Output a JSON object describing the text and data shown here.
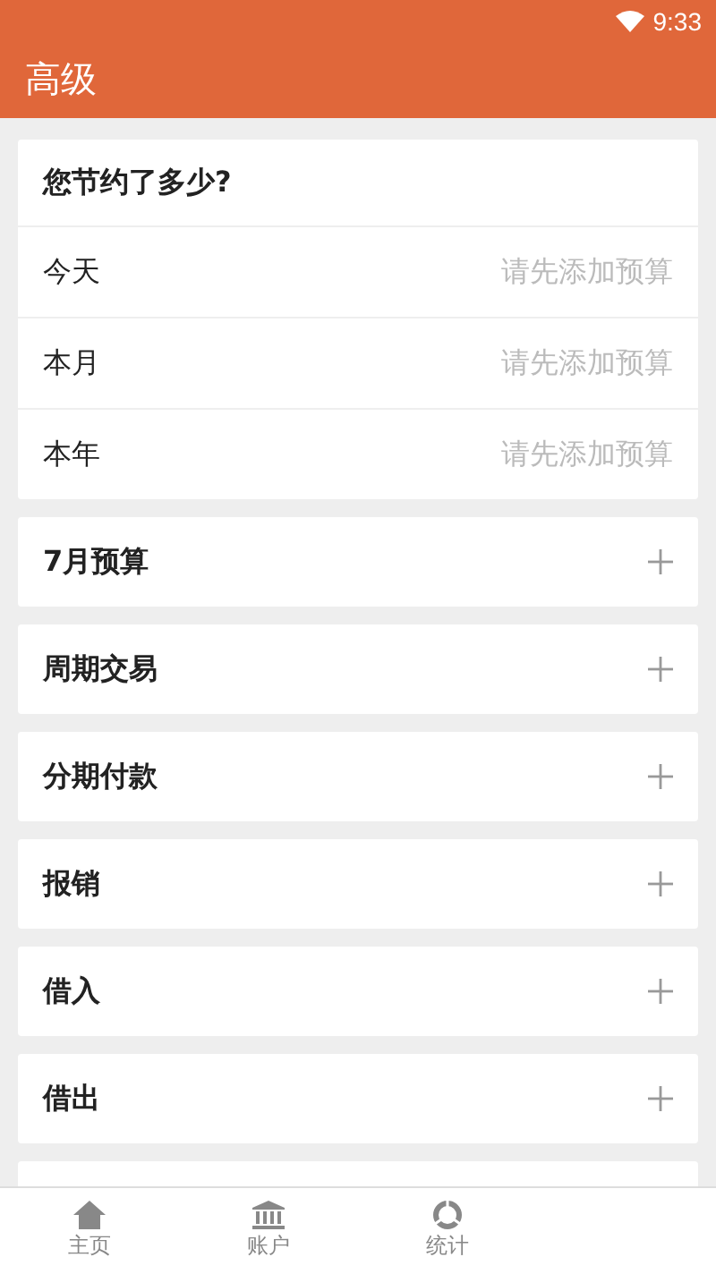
{
  "status_bar": {
    "time": "9:33"
  },
  "app_bar": {
    "title": "高级"
  },
  "savings_card": {
    "title": "您节约了多少?",
    "rows": [
      {
        "label": "今天",
        "value": "请先添加预算"
      },
      {
        "label": "本月",
        "value": "请先添加预算"
      },
      {
        "label": "本年",
        "value": "请先添加预算"
      }
    ]
  },
  "sections": [
    {
      "title": "7月预算",
      "expanded": false
    },
    {
      "title": "周期交易",
      "expanded": false
    },
    {
      "title": "分期付款",
      "expanded": false
    },
    {
      "title": "报销",
      "expanded": false
    },
    {
      "title": "借入",
      "expanded": false
    },
    {
      "title": "借出",
      "expanded": false
    }
  ],
  "bottom_nav": [
    {
      "label": "主页",
      "selected": false
    },
    {
      "label": "账户",
      "selected": false
    },
    {
      "label": "统计",
      "selected": false
    }
  ]
}
